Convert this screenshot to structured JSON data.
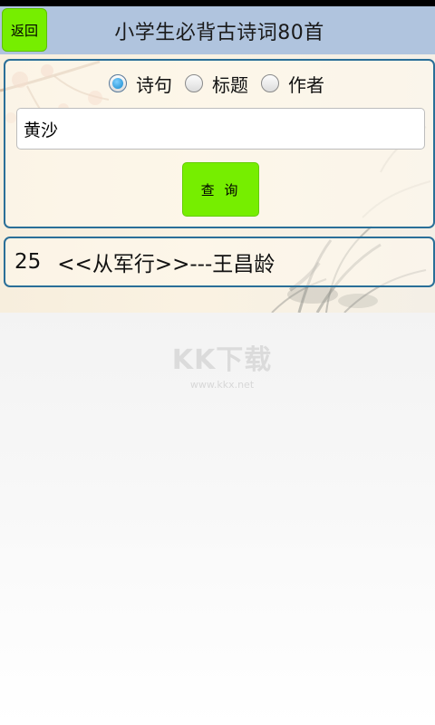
{
  "header": {
    "back_label": "返回",
    "title": "小学生必背古诗词80首"
  },
  "search": {
    "options": [
      {
        "label": "诗句",
        "checked": true
      },
      {
        "label": "标题",
        "checked": false
      },
      {
        "label": "作者",
        "checked": false
      }
    ],
    "value": "黄沙",
    "button_label": "查 询"
  },
  "results": [
    {
      "number": "25",
      "text": "<<从军行>>---王昌龄"
    }
  ],
  "watermark": {
    "logo": "KK下载",
    "url": "www.kkx.net"
  },
  "colors": {
    "title_bar": "#b0c4de",
    "button_green": "#76ee00",
    "border_blue": "#2a6f98",
    "radio_blue": "#1588cc"
  }
}
